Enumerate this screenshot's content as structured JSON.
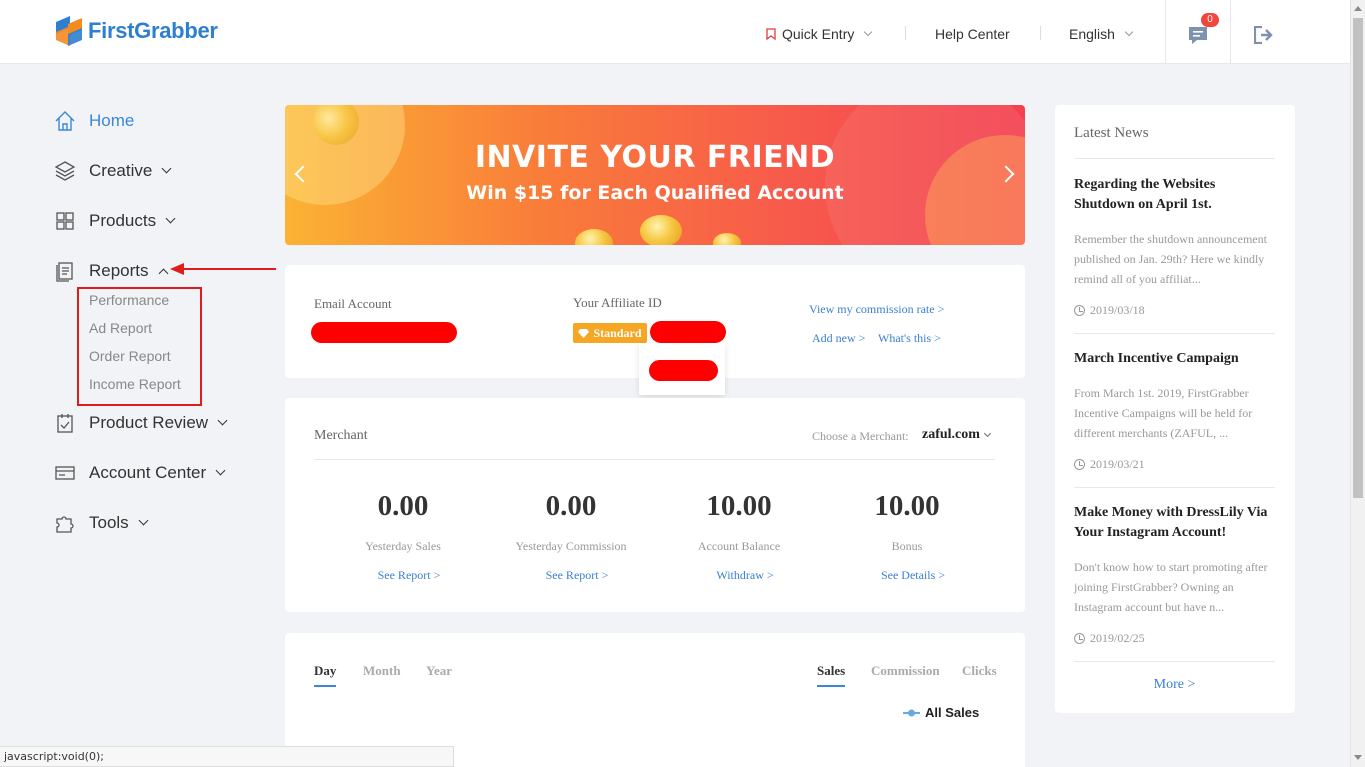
{
  "header": {
    "logo_text": "FirstGrabber",
    "quick_entry": "Quick Entry",
    "help_center": "Help Center",
    "language": "English",
    "message_count": "0"
  },
  "sidebar": {
    "items": [
      {
        "label": "Home",
        "icon": "home-icon"
      },
      {
        "label": "Creative",
        "icon": "layers-icon"
      },
      {
        "label": "Products",
        "icon": "grid-icon"
      },
      {
        "label": "Reports",
        "icon": "report-icon"
      },
      {
        "label": "Product Review",
        "icon": "review-icon"
      },
      {
        "label": "Account Center",
        "icon": "card-icon"
      },
      {
        "label": "Tools",
        "icon": "puzzle-icon"
      }
    ],
    "reports_sub": [
      "Performance",
      "Ad Report",
      "Order Report",
      "Income Report"
    ]
  },
  "banner": {
    "title": "INVITE YOUR FRIEND",
    "subtitle": "Win $15 for Each Qualified Account"
  },
  "account": {
    "email_label": "Email Account",
    "affiliate_label": "Your Affiliate ID",
    "tier_badge": "Standard",
    "commission_link": "View my commission rate >",
    "add_new_link": "Add new >",
    "whats_this_link": "What's this >"
  },
  "merchant": {
    "title": "Merchant",
    "choose_label": "Choose a Merchant:",
    "selected": "zaful.com",
    "stats": [
      {
        "value": "0.00",
        "label": "Yesterday Sales",
        "link": "See Report >"
      },
      {
        "value": "0.00",
        "label": "Yesterday Commission",
        "link": "See Report >"
      },
      {
        "value": "10.00",
        "label": "Account Balance",
        "link": "Withdraw >"
      },
      {
        "value": "10.00",
        "label": "Bonus",
        "link": "See Details >"
      }
    ]
  },
  "chart_panel": {
    "period_tabs": [
      "Day",
      "Month",
      "Year"
    ],
    "metric_tabs": [
      "Sales",
      "Commission",
      "Clicks"
    ],
    "legend": "All Sales"
  },
  "news": {
    "heading": "Latest News",
    "items": [
      {
        "title": "Regarding the Websites Shutdown on April 1st.",
        "body": "Remember the shutdown announcement published on Jan. 29th? Here we kindly remind all of you affiliat...",
        "date": "2019/03/18"
      },
      {
        "title": "March Incentive Campaign",
        "body": "From March 1st. 2019, FirstGrabber Incentive Campaigns will be held for different merchants (ZAFUL, ...",
        "date": "2019/03/21"
      },
      {
        "title": "Make Money with DressLily Via Your Instagram Account!",
        "body": "Don't know how to start promoting after joining FirstGrabber? Owning an Instagram account but have n...",
        "date": "2019/02/25"
      }
    ],
    "more": "More >"
  },
  "status_bar": "javascript:void(0);",
  "colors": {
    "accent": "#3a87d6",
    "redaction": "#ff0000",
    "badge": "#f5a623"
  }
}
